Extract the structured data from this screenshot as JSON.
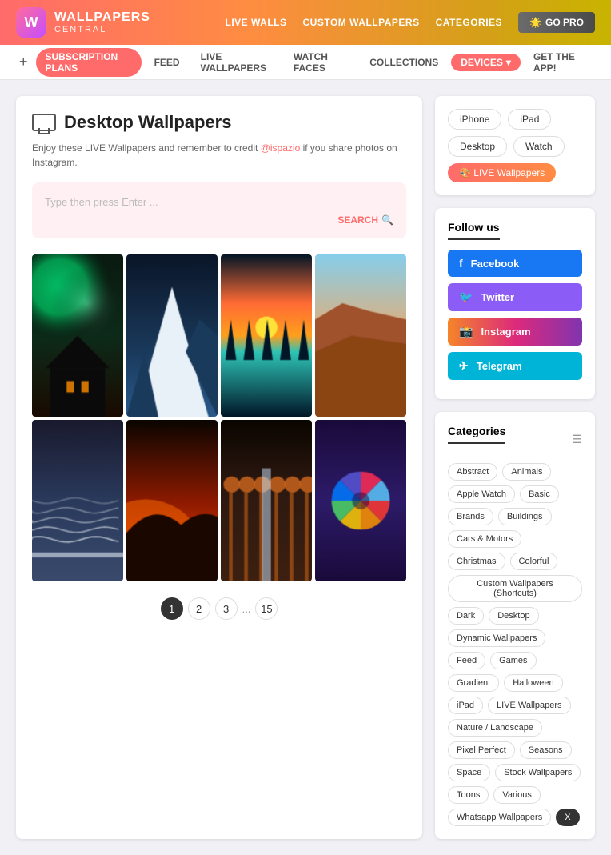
{
  "header": {
    "logo_letter": "W",
    "logo_title": "WALLPAPERS",
    "logo_sub": "CENTRAL",
    "nav_links": [
      "LIVE WALLS",
      "CUSTOM WALLPAPERS",
      "CATEGORIES"
    ],
    "go_pro_label": "GO PRO"
  },
  "subnav": {
    "plus": "+",
    "items": [
      {
        "label": "SUBSCRIPTION PLANS",
        "active": true
      },
      {
        "label": "FEED"
      },
      {
        "label": "LIVE WALLPAPERS"
      },
      {
        "label": "WATCH FACES"
      },
      {
        "label": "COLLECTIONS"
      },
      {
        "label": "DEVICES",
        "special": "devices"
      },
      {
        "label": "GET THE APP!"
      }
    ]
  },
  "main": {
    "page_icon": "desktop",
    "page_title": "Desktop Wallpapers",
    "page_desc_pre": "Enjoy these LIVE Wallpapers and remember to credit ",
    "page_desc_handle": "@ispazio",
    "page_desc_post": " if you share photos on Instagram.",
    "search_placeholder": "Type then press Enter ...",
    "search_btn": "SEARCH"
  },
  "pagination": {
    "pages": [
      "1",
      "2",
      "3"
    ],
    "dots": "...",
    "last": "15"
  },
  "sidebar": {
    "devices": {
      "pills": [
        "iPhone",
        "iPad",
        "Desktop",
        "Watch"
      ],
      "live_label": "🎨 LIVE Wallpapers"
    },
    "follow": {
      "title": "Follow us",
      "socials": [
        {
          "label": "Facebook",
          "class": "facebook",
          "icon": "f"
        },
        {
          "label": "Twitter",
          "class": "twitter",
          "icon": "t"
        },
        {
          "label": "Instagram",
          "class": "instagram",
          "icon": "📷"
        },
        {
          "label": "Telegram",
          "class": "telegram",
          "icon": "✈"
        }
      ]
    },
    "categories": {
      "title": "Categories",
      "tags": [
        "Abstract",
        "Animals",
        "Apple Watch",
        "Basic",
        "Brands",
        "Buildings",
        "Cars & Motors",
        "Christmas",
        "Colorful",
        "Custom Wallpapers (Shortcuts)",
        "Dark",
        "Desktop",
        "Dynamic Wallpapers",
        "Feed",
        "Games",
        "Gradient",
        "Halloween",
        "iPad",
        "LIVE Wallpapers",
        "Nature / Landscape",
        "Pixel Perfect",
        "Seasons",
        "Space",
        "Stock Wallpapers",
        "Toons",
        "Various",
        "Whatsapp Wallpapers",
        "X"
      ]
    }
  },
  "images": [
    {
      "id": 1,
      "colors": [
        "#0d2b1a",
        "#00ff88",
        "#1a4a2e",
        "#ff8c00"
      ],
      "type": "aurora"
    },
    {
      "id": 2,
      "colors": [
        "#0a1628",
        "#1a3a5c",
        "#2a5a8c"
      ],
      "type": "mountain_snow"
    },
    {
      "id": 3,
      "colors": [
        "#ff6b35",
        "#ff9f1c",
        "#2ec4b6",
        "#011627"
      ],
      "type": "sunset_lake"
    },
    {
      "id": 4,
      "colors": [
        "#8b4513",
        "#a0522d",
        "#d2691e",
        "#87ceeb"
      ],
      "type": "rocky"
    },
    {
      "id": 5,
      "colors": [
        "#1a1a2e",
        "#16213e",
        "#e0e0e0",
        "#a0a0c0"
      ],
      "type": "coast"
    },
    {
      "id": 6,
      "colors": [
        "#1a0a00",
        "#8b1a00",
        "#ff4500",
        "#ff6b00"
      ],
      "type": "desert"
    },
    {
      "id": 7,
      "colors": [
        "#1a0a05",
        "#8b4513",
        "#d2691e",
        "#2c1810"
      ],
      "type": "forest_fall"
    },
    {
      "id": 8,
      "colors": [
        "#1a0a3a",
        "#2d1b69",
        "#ff6b9d",
        "#ffb347"
      ],
      "type": "apple_logo"
    }
  ]
}
